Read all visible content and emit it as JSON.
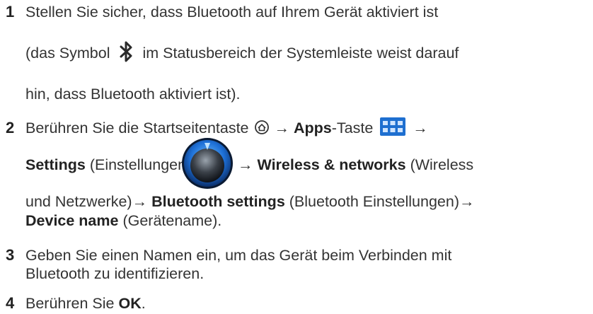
{
  "steps": [
    {
      "number": "1",
      "lines": [
        {
          "text": "Stellen Sie sicher, dass Bluetooth auf Ihrem Gerät aktiviert ist"
        },
        {
          "before": "(das Symbol",
          "after": "im Statusbereich der Systemleiste weist darauf",
          "icon": "bluetooth-icon"
        },
        {
          "text": "hin, dass Bluetooth aktiviert ist)."
        }
      ]
    },
    {
      "number": "2",
      "line1": {
        "text": "Berühren Sie die Startseitentaste",
        "home_icon": "home-icon",
        "arrow1": "→",
        "apps_bold": "Apps",
        "apps_rest": "-Taste",
        "apps_icon": "apps-grid-icon",
        "arrow2": "→"
      },
      "line2": {
        "settings_bold": "Settings",
        "settings_rest": "(Einstellungen)",
        "settings_icon": "settings-icon",
        "arrow": "→",
        "wireless_bold": "Wireless & networks",
        "wireless_rest": "(Wireless"
      },
      "line3": {
        "text": "und Netzwerke)→",
        "bt_bold": "Bluetooth settings",
        "bt_rest": "(Bluetooth Einstellungen)→"
      },
      "line4": {
        "device_bold": "Device name",
        "device_rest": "(Gerätename)."
      }
    },
    {
      "number": "3",
      "lines": [
        {
          "text": "Geben Sie einen Namen ein, um das Gerät beim Verbinden mit"
        },
        {
          "text": "Bluetooth zu identifizieren."
        }
      ]
    },
    {
      "number": "4",
      "before": "Berühren Sie",
      "bold": "OK",
      "after": "."
    }
  ],
  "colors": {
    "text": "#333333",
    "accent_blue": "#1e6fd0"
  }
}
